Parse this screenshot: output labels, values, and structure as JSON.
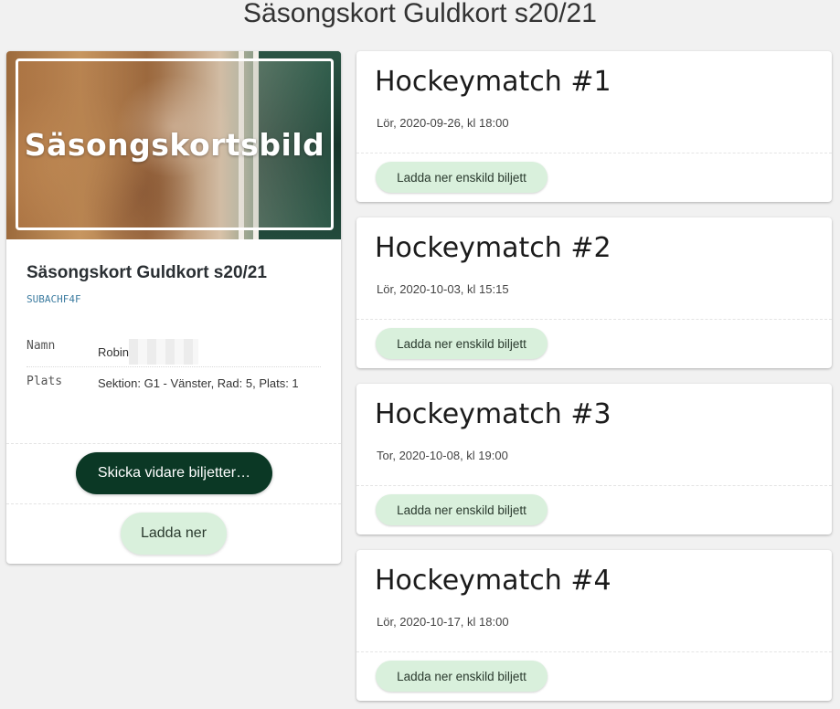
{
  "page": {
    "title": "Säsongskort Guldkort s20/21"
  },
  "season_card": {
    "image_caption": "Säsongskortsbild",
    "title": "Säsongskort Guldkort s20/21",
    "code": "SUBACHF4F",
    "fields": [
      {
        "label": "Namn",
        "value": "Robin"
      },
      {
        "label": "Plats",
        "value": "Sektion: G1 - Vänster, Rad: 5, Plats: 1"
      }
    ],
    "forward_button": "Skicka vidare biljetter…",
    "download_button": "Ladda ner"
  },
  "matches": [
    {
      "title": "Hockeymatch #1",
      "date": "Lör, 2020-09-26, kl 18:00",
      "button": "Ladda ner enskild biljett"
    },
    {
      "title": "Hockeymatch #2",
      "date": "Lör, 2020-10-03, kl 15:15",
      "button": "Ladda ner enskild biljett"
    },
    {
      "title": "Hockeymatch #3",
      "date": "Tor, 2020-10-08, kl 19:00",
      "button": "Ladda ner enskild biljett"
    },
    {
      "title": "Hockeymatch #4",
      "date": "Lör, 2020-10-17, kl 18:00",
      "button": "Ladda ner enskild biljett"
    }
  ],
  "colors": {
    "primary_dark_green": "#0b3825",
    "light_green_button": "#d9f0dc",
    "code_blue": "#3c7ca0",
    "background": "#f1f1f1"
  }
}
